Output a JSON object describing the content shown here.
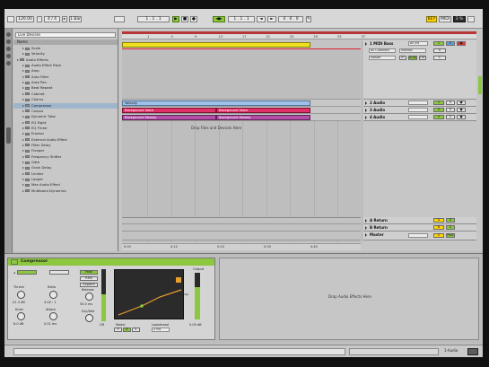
{
  "transport": {
    "tempo": "120.00",
    "signature": "4 / 4",
    "quantize": "1 Bar",
    "position": "1 . 1 . 1",
    "loop_start": "1 . 1 . 1",
    "loop_length": "4 . 0 . 0",
    "key_label": "KEY",
    "midi_label": "MIDI",
    "cpu": "3 %"
  },
  "browser": {
    "search_value": "Live Devices",
    "header_label": "Name",
    "items": [
      {
        "label": "Scale",
        "indent": 1,
        "kind": "device"
      },
      {
        "label": "Velocity",
        "indent": 1,
        "kind": "device"
      },
      {
        "label": "Audio Effects",
        "indent": 0,
        "kind": "folder"
      },
      {
        "label": "Audio Effect Rack",
        "indent": 1,
        "kind": "device"
      },
      {
        "label": "Amp",
        "indent": 1,
        "kind": "device"
      },
      {
        "label": "Auto Filter",
        "indent": 1,
        "kind": "device"
      },
      {
        "label": "Auto Pan",
        "indent": 1,
        "kind": "device"
      },
      {
        "label": "Beat Repeat",
        "indent": 1,
        "kind": "device"
      },
      {
        "label": "Cabinet",
        "indent": 1,
        "kind": "device"
      },
      {
        "label": "Chorus",
        "indent": 1,
        "kind": "device"
      },
      {
        "label": "Compressor",
        "indent": 1,
        "kind": "device",
        "selected": true
      },
      {
        "label": "Corpus",
        "indent": 1,
        "kind": "device"
      },
      {
        "label": "Dynamic Tube",
        "indent": 1,
        "kind": "device"
      },
      {
        "label": "EQ Eight",
        "indent": 1,
        "kind": "device"
      },
      {
        "label": "EQ Three",
        "indent": 1,
        "kind": "device"
      },
      {
        "label": "Erosion",
        "indent": 1,
        "kind": "device"
      },
      {
        "label": "External Audio Effect",
        "indent": 1,
        "kind": "device"
      },
      {
        "label": "Filter Delay",
        "indent": 1,
        "kind": "device"
      },
      {
        "label": "Flanger",
        "indent": 1,
        "kind": "device"
      },
      {
        "label": "Frequency Shifter",
        "indent": 1,
        "kind": "device"
      },
      {
        "label": "Gate",
        "indent": 1,
        "kind": "device"
      },
      {
        "label": "Grain Delay",
        "indent": 1,
        "kind": "device"
      },
      {
        "label": "Limiter",
        "indent": 1,
        "kind": "device"
      },
      {
        "label": "Looper",
        "indent": 1,
        "kind": "device"
      },
      {
        "label": "Max Audio Effect",
        "indent": 1,
        "kind": "device"
      },
      {
        "label": "Multiband Dynamics",
        "indent": 1,
        "kind": "device"
      }
    ]
  },
  "arrangement": {
    "ruler_ticks": [
      "1",
      "5",
      "9",
      "13",
      "17",
      "21",
      "25",
      "29",
      "33",
      "37"
    ],
    "time_labels": [
      "0:00",
      "0:10",
      "0:20",
      "0:30",
      "0:40"
    ],
    "drop_files_label": "Drop Files and Devices Here",
    "clips": {
      "midi_clip": "",
      "audio_clip_1": "Velocity",
      "audio_clip_2a": "Background Voice",
      "audio_clip_2b": "Background Voice",
      "audio_clip_3a": "Background Melody",
      "audio_clip_3b": "Background Melody"
    }
  },
  "tracks": [
    {
      "name": "1 MIDI Bass",
      "number": "1",
      "sub1": "All Ins",
      "sub2": "All Channels",
      "sub3": "Monitor",
      "sub4": "Master",
      "in": "In",
      "auto": "Auto",
      "off": "Off"
    },
    {
      "name": "2 Audio",
      "number": "2"
    },
    {
      "name": "3 Audio",
      "number": "3"
    },
    {
      "name": "4 Audio",
      "number": "4"
    }
  ],
  "returns": [
    {
      "name": "A Return",
      "letter": "A"
    },
    {
      "name": "B Return",
      "letter": "B"
    }
  ],
  "master": {
    "name": "Master",
    "label": "Post",
    "vol": "0"
  },
  "device": {
    "title": "Compressor",
    "thresh_label": "Thresh",
    "ratio_label": "Ratio",
    "attack_label": "Attack",
    "release_label": "Release",
    "knee_label": "Knee",
    "makeup_label": "Makeup",
    "dry_wet_label": "Dry/Wet",
    "output_label": "Output",
    "gain_reduction_label": "GR",
    "peak_label": "Peak",
    "rms_label": "RMS",
    "expand_label": "Expand",
    "model_label": "Model",
    "lookahead_label": "Lookahead",
    "thresh_val": "-21.3 dB",
    "ratio_val": "4.00 : 1",
    "attack_val": "0.01 ms",
    "release_val": "50.0 ms",
    "knee_val": "6.0 dB",
    "output_val": "0.00 dB",
    "lookahead_val": "0 ms"
  },
  "drop_fx_label": "Drop Audio Effects Here",
  "status": {
    "left_text": "",
    "track_label": "1-Audio"
  },
  "colors": {
    "yellow_clip": "#f0e020",
    "red_clip": "#e0306a",
    "purple_clip": "#b34fa8",
    "blue_clip": "#9fc0e8",
    "green": "#8dc63f",
    "yellow": "#ffd400"
  }
}
